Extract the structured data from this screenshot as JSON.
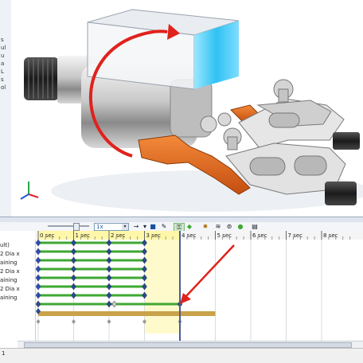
{
  "feature_tree": {
    "items": [
      {
        "label": "s"
      },
      {
        "label": "ul"
      },
      {
        "label": "u"
      },
      {
        "label": "a"
      },
      {
        "label": "L"
      },
      {
        "label": "s"
      },
      {
        "label": "ol"
      }
    ]
  },
  "toolbar": {
    "playback_value": "1x",
    "buttons": [
      {
        "name": "play-forward-icon",
        "glyph": "▶"
      },
      {
        "name": "save-animation-icon",
        "glyph": "💾"
      },
      {
        "name": "calculate-icon",
        "glyph": "⚙"
      },
      {
        "name": "autokey-icon",
        "glyph": "🔑"
      },
      {
        "name": "add-update-key-icon",
        "glyph": "◆"
      },
      {
        "name": "motor-icon",
        "glyph": "⚙"
      },
      {
        "name": "spring-icon",
        "glyph": "≋"
      },
      {
        "name": "contact-icon",
        "glyph": "●"
      },
      {
        "name": "gravity-icon",
        "glyph": "▣"
      }
    ]
  },
  "timeline": {
    "time_labels": [
      "0 sec",
      "1 sec",
      "2 sec",
      "3 sec",
      "4 sec",
      "5 sec",
      "6 sec",
      "7 sec",
      "8 sec"
    ],
    "rows": [
      {
        "name": "ult)"
      },
      {
        "name": "2 Dia x"
      },
      {
        "name": "aining"
      },
      {
        "name": "2 Dia x"
      },
      {
        "name": "aining"
      },
      {
        "name": "2 Dia x"
      },
      {
        "name": "aining"
      }
    ]
  },
  "status": {
    "index": "1"
  },
  "colors": {
    "key_green": "#3ea832",
    "playhead": "#4a5a9a",
    "highlight_band": "#fff7a8",
    "gold_bar": "#c9a24a",
    "arrow_red": "#e0221c",
    "gripper_orange": "#e2661a",
    "box_cyan": "#35c8f0"
  }
}
